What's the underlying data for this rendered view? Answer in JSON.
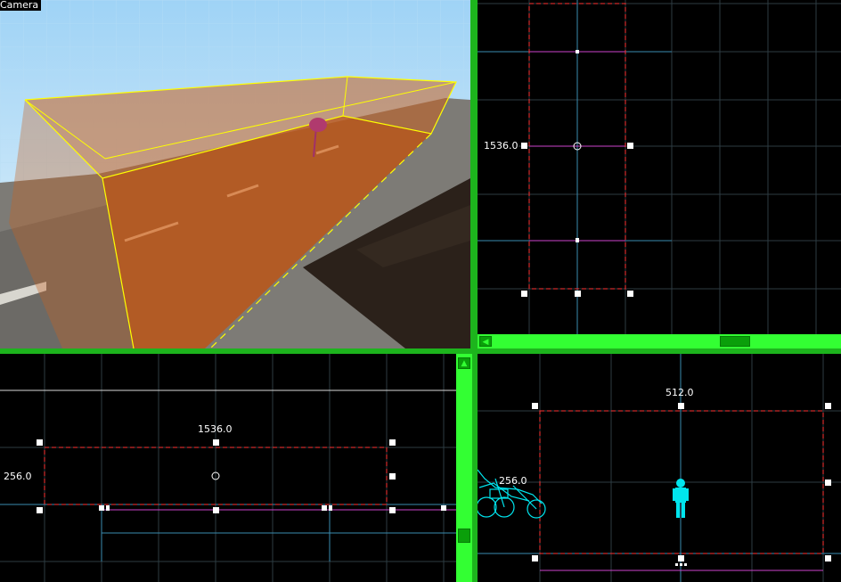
{
  "camera_view": {
    "label": "Camera"
  },
  "top_view": {
    "dimension_label": "1536.0"
  },
  "front_view": {
    "width_label": "1536.0",
    "height_label": "256.0"
  },
  "side_view": {
    "width_label": "512.0",
    "height_label": "256.0"
  },
  "colors": {
    "background": "#000000",
    "grid": "#2e3c42",
    "grid_axis": "#3a8bb0",
    "selection": "#ff3333",
    "brush_outline": "#ffff00",
    "brush_fill": "#c8611f",
    "entity": "#00e5ee",
    "highlight_line": "#cc44cc",
    "splitter": "#1db41d",
    "scrollbar": "#33ff33"
  }
}
